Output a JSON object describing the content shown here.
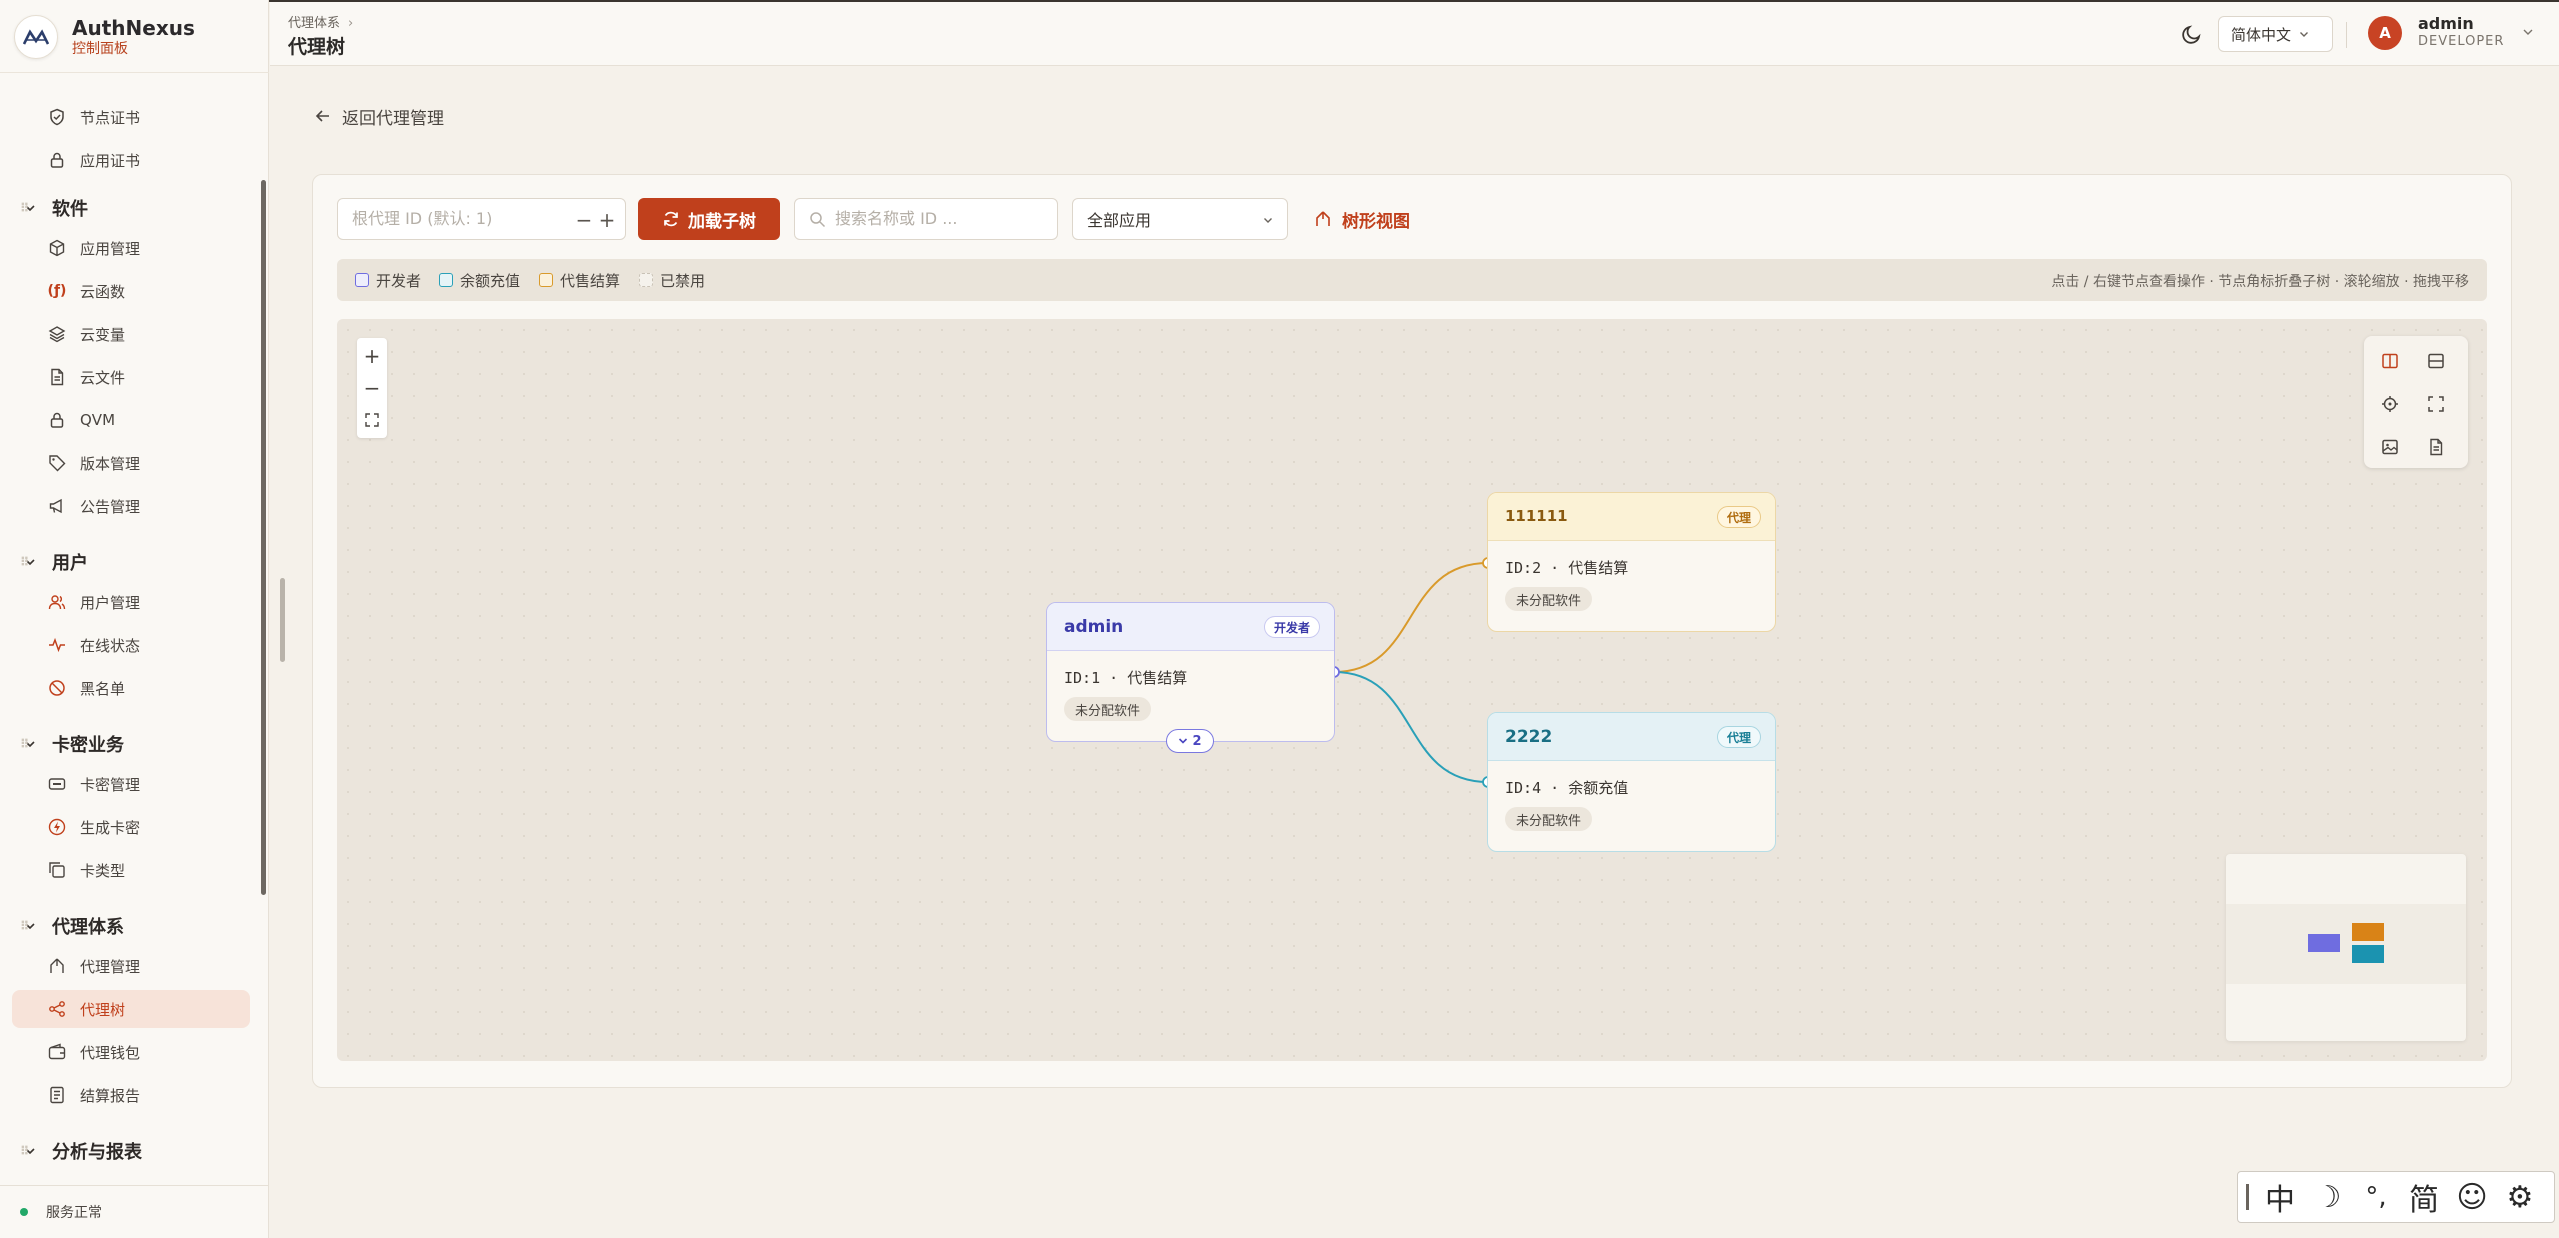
{
  "brand": {
    "name": "AuthNexus",
    "subtitle": "控制面板"
  },
  "sidebar": {
    "items_top": [
      {
        "label": "节点证书",
        "icon": "shield-check-icon"
      },
      {
        "label": "应用证书",
        "icon": "lock-icon"
      }
    ],
    "sections": [
      {
        "title": "软件",
        "items": [
          {
            "label": "应用管理",
            "icon": "cube-icon"
          },
          {
            "label": "云函数",
            "icon": "function-icon"
          },
          {
            "label": "云变量",
            "icon": "layers-icon"
          },
          {
            "label": "云文件",
            "icon": "file-icon"
          },
          {
            "label": "QVM",
            "icon": "lock-icon"
          },
          {
            "label": "版本管理",
            "icon": "tag-icon"
          },
          {
            "label": "公告管理",
            "icon": "megaphone-icon"
          }
        ]
      },
      {
        "title": "用户",
        "items": [
          {
            "label": "用户管理",
            "icon": "users-icon"
          },
          {
            "label": "在线状态",
            "icon": "activity-icon"
          },
          {
            "label": "黑名单",
            "icon": "ban-icon"
          }
        ]
      },
      {
        "title": "卡密业务",
        "items": [
          {
            "label": "卡密管理",
            "icon": "card-icon"
          },
          {
            "label": "生成卡密",
            "icon": "bolt-icon"
          },
          {
            "label": "卡类型",
            "icon": "copy-icon"
          }
        ]
      },
      {
        "title": "代理体系",
        "items": [
          {
            "label": "代理管理",
            "icon": "hierarchy-icon"
          },
          {
            "label": "代理树",
            "icon": "share-icon",
            "active": true
          },
          {
            "label": "代理钱包",
            "icon": "wallet-icon"
          },
          {
            "label": "结算报告",
            "icon": "report-icon"
          }
        ]
      },
      {
        "title": "分析与报表",
        "items": []
      }
    ],
    "status": "服务正常"
  },
  "header": {
    "breadcrumb": "代理体系",
    "title": "代理树",
    "language": "简体中文",
    "user": {
      "initial": "A",
      "name": "admin",
      "role": "DEVELOPER"
    }
  },
  "back_label": "返回代理管理",
  "toolbar": {
    "root_placeholder": "根代理 ID (默认: 1)",
    "load_button": "加载子树",
    "search_placeholder": "搜索名称或 ID ...",
    "app_select": "全部应用",
    "tree_view": "树形视图"
  },
  "legend": {
    "items": [
      {
        "label": "开发者",
        "color": "#6f6de0"
      },
      {
        "label": "余额充值",
        "color": "#2aa0b8"
      },
      {
        "label": "代售结算",
        "color": "#d99a2b"
      },
      {
        "label": "已禁用",
        "color": "#c9c2b6"
      }
    ],
    "hint": "点击 / 右键节点查看操作 · 节点角标折叠子树 · 滚轮缩放 · 拖拽平移"
  },
  "tree": {
    "nodes": [
      {
        "key": "admin",
        "name": "admin",
        "badge": "开发者",
        "id_text": "ID:1 · 代售结算",
        "software": "未分配软件",
        "child_count": "2"
      },
      {
        "key": "n2",
        "name": "111111",
        "badge": "代理",
        "id_text": "ID:2 · 代售结算",
        "software": "未分配软件"
      },
      {
        "key": "n4",
        "name": "2222",
        "badge": "代理",
        "id_text": "ID:4 · 余额充值",
        "software": "未分配软件"
      }
    ]
  },
  "ime": {
    "keys": [
      "中",
      "☽",
      "°,",
      "简",
      "☺",
      "⚙"
    ]
  }
}
